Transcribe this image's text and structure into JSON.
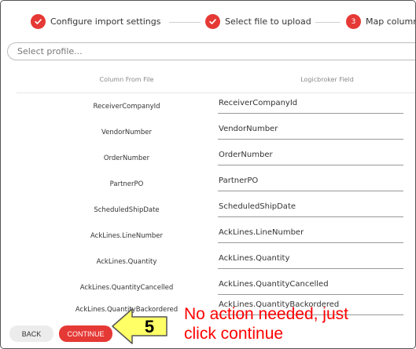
{
  "stepper": {
    "steps": [
      {
        "label": "Configure import settings",
        "state": "done"
      },
      {
        "label": "Select file to upload",
        "state": "done"
      },
      {
        "label": "Map column",
        "state": "current",
        "number": "3"
      }
    ]
  },
  "profile": {
    "placeholder": "Select profile..."
  },
  "table": {
    "headers": {
      "left": "Column From File",
      "right": "Logicbroker Field"
    },
    "rows": [
      {
        "source": "ReceiverCompanyId",
        "field": "ReceiverCompanyId"
      },
      {
        "source": "VendorNumber",
        "field": "VendorNumber"
      },
      {
        "source": "OrderNumber",
        "field": "OrderNumber"
      },
      {
        "source": "PartnerPO",
        "field": "PartnerPO"
      },
      {
        "source": "ScheduledShipDate",
        "field": "ScheduledShipDate"
      },
      {
        "source": "AckLines.LineNumber",
        "field": "AckLines.LineNumber"
      },
      {
        "source": "AckLines.Quantity",
        "field": "AckLines.Quantity"
      },
      {
        "source": "AckLines.QuantityCancelled",
        "field": "AckLines.QuantityCancelled"
      },
      {
        "source": "AckLines.QuantityBackordered",
        "field": "AckLines.QuantityBackordered"
      }
    ]
  },
  "buttons": {
    "back": "BACK",
    "continue": "CONTINUE"
  },
  "annotation": {
    "step_number": "5",
    "note_line1": "No action needed, just",
    "note_line2": "click continue"
  },
  "colors": {
    "accent": "#e53935",
    "annotation_text": "#ff0000",
    "callout_fill": "#ffff66"
  }
}
